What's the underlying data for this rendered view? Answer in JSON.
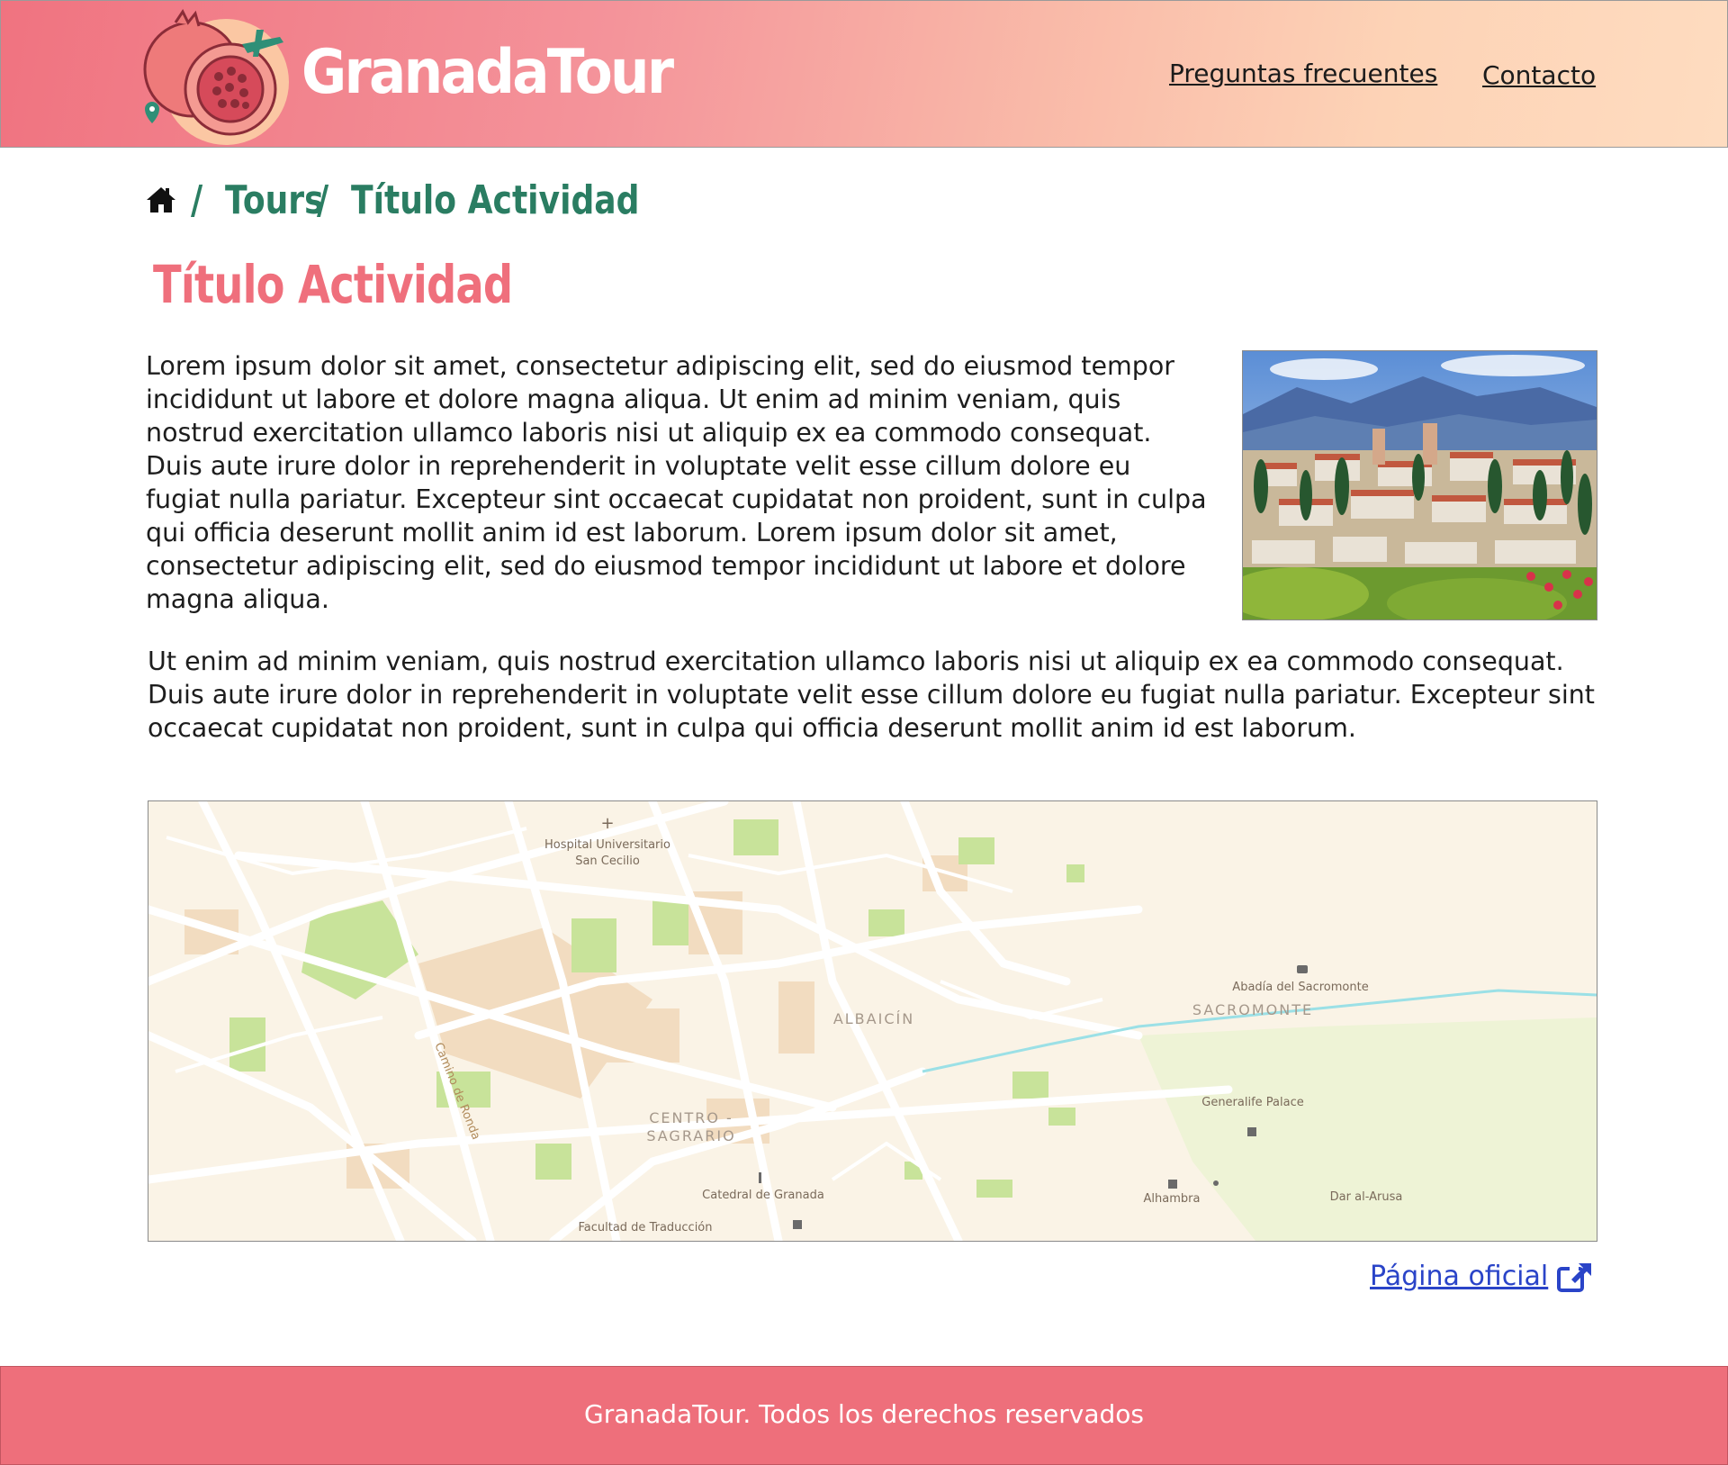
{
  "header": {
    "brand": "GranadaTour",
    "logo_icon": "pomegranate-plane-logo-icon",
    "nav": [
      {
        "label": "Preguntas frecuentes"
      },
      {
        "label": "Contacto"
      }
    ]
  },
  "breadcrumb": {
    "home_icon": "home-icon",
    "separator": "/",
    "items": [
      {
        "label": "Tours"
      },
      {
        "label": "Título Actividad"
      }
    ]
  },
  "page": {
    "title": "Título Actividad",
    "paragraph1": "Lorem ipsum dolor sit amet, consectetur adipiscing elit, sed do eiusmod tempor incididunt ut labore et dolore magna aliqua. Ut enim ad minim veniam, quis nostrud exercitation ullamco laboris nisi ut aliquip ex ea commodo consequat. Duis aute irure dolor in reprehenderit in voluptate velit esse cillum dolore eu fugiat nulla pariatur. Excepteur sint occaecat cupidatat non proident, sunt in culpa qui officia deserunt mollit anim id est laborum. Lorem ipsum dolor sit amet, consectetur adipiscing elit, sed do eiusmod tempor incididunt ut labore et dolore magna aliqua.",
    "paragraph2": "Ut enim ad minim veniam, quis nostrud exercitation ullamco laboris nisi ut aliquip ex ea commodo consequat. Duis aute irure dolor in reprehenderit in voluptate velit esse cillum dolore eu fugiat nulla pariatur. Excepteur sint occaecat cupidatat non proident, sunt in culpa qui officia deserunt mollit anim id est laborum.",
    "official_link": "Página oficial",
    "official_icon": "external-link-icon"
  },
  "map": {
    "labels": {
      "hospital": "Hospital Universitario",
      "hospital2": "San Cecilio",
      "abadia": "Abadía del Sacromonte",
      "sacromonte": "SACROMONTE",
      "albaicin": "ALBAICÍN",
      "centro": "CENTRO -",
      "sagrario": "SAGRARIO",
      "camino": "Camino de Ronda",
      "generalife": "Generalife Palace",
      "alhambra": "Alhambra",
      "dar": "Dar al-Arusa",
      "catedral": "Catedral de Granada",
      "facultad": "Facultad de Traducción"
    }
  },
  "footer": {
    "text": "GranadaTour. Todos los derechos reservados"
  },
  "colors": {
    "header_start": "#f07380",
    "header_end": "#fedcc0",
    "breadcrumb": "#2a7d62",
    "title": "#ef6f7c",
    "footer": "#ee6f7b",
    "link": "#2a44c8"
  }
}
